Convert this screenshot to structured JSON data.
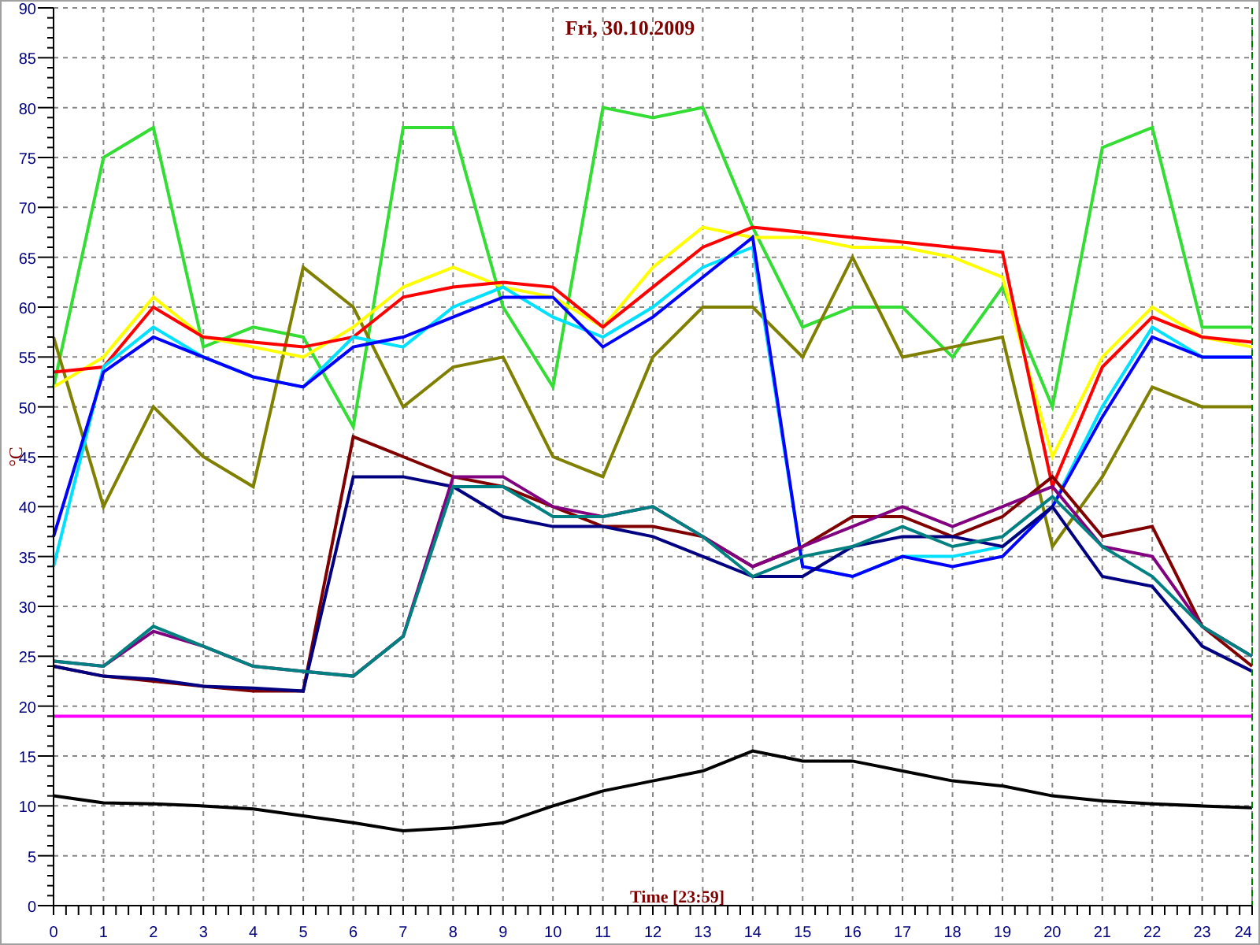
{
  "chart": {
    "chart_data": {
      "type": "line",
      "title": "Fri, 30.10.2009",
      "xlabel": "Time [23:59]",
      "ylabel": "°C",
      "x": [
        0,
        1,
        2,
        3,
        4,
        5,
        6,
        7,
        8,
        9,
        10,
        11,
        12,
        13,
        14,
        15,
        16,
        17,
        18,
        19,
        20,
        21,
        22,
        23,
        24
      ],
      "grid": true,
      "xlim": [
        0,
        24
      ],
      "ylim": [
        0,
        90
      ],
      "xticks": [
        0,
        1,
        2,
        3,
        4,
        5,
        6,
        7,
        8,
        9,
        10,
        11,
        12,
        13,
        14,
        15,
        16,
        17,
        18,
        19,
        20,
        21,
        22,
        23,
        24
      ],
      "yticks": [
        0,
        5,
        10,
        15,
        20,
        25,
        30,
        35,
        40,
        45,
        50,
        55,
        60,
        65,
        70,
        75,
        80,
        85,
        90
      ],
      "series": [
        {
          "color": "#33dd33",
          "values": [
            52,
            75,
            78,
            56,
            58,
            57,
            48,
            78,
            78,
            60,
            52,
            80,
            79,
            80,
            68,
            58,
            60,
            60,
            55,
            62,
            50,
            76,
            78,
            58,
            58
          ]
        },
        {
          "color": "#808000",
          "values": [
            57,
            40,
            50,
            45,
            42,
            64,
            60,
            50,
            54,
            55,
            45,
            43,
            55,
            60,
            60,
            55,
            65,
            55,
            56,
            57,
            36,
            43,
            52,
            50,
            50
          ]
        },
        {
          "color": "#ffff00",
          "values": [
            52,
            55,
            61,
            57,
            56,
            55,
            58,
            62,
            64,
            62,
            61,
            58,
            64,
            68,
            67,
            67,
            66,
            66,
            65,
            63,
            45,
            55,
            60,
            57,
            56
          ]
        },
        {
          "color": "#ff0000",
          "values": [
            53.5,
            54,
            60,
            57,
            56.5,
            56,
            57,
            61,
            62,
            62.5,
            62,
            58,
            62,
            66,
            68,
            67.5,
            67,
            66.5,
            66,
            65.5,
            42,
            54,
            59,
            57,
            56.5
          ]
        },
        {
          "color": "#00e0ff",
          "values": [
            34,
            54,
            58,
            55,
            53,
            52,
            57,
            56,
            60,
            62,
            59,
            57,
            60,
            64,
            66,
            34,
            33,
            35,
            35,
            36,
            40,
            50,
            58,
            55,
            55
          ]
        },
        {
          "color": "#0000ff",
          "values": [
            37,
            53.5,
            57,
            55,
            53,
            52,
            56,
            57,
            59,
            61,
            61,
            56,
            59,
            63,
            67,
            34,
            33,
            35,
            34,
            35,
            40,
            49,
            57,
            55,
            55
          ]
        },
        {
          "color": "#800000",
          "values": [
            24,
            23,
            22.5,
            22,
            21.5,
            21.5,
            47,
            45,
            43,
            42,
            40,
            38,
            38,
            37,
            34,
            36,
            39,
            39,
            37,
            39,
            43,
            37,
            38,
            28,
            24
          ]
        },
        {
          "color": "#000080",
          "values": [
            24,
            23,
            22.7,
            22,
            21.8,
            21.5,
            43,
            43,
            42,
            39,
            38,
            38,
            37,
            35,
            33,
            33,
            36,
            37,
            37,
            36,
            40,
            33,
            32,
            26,
            23.5
          ]
        },
        {
          "color": "#800080",
          "values": [
            24.5,
            24,
            27.5,
            26,
            24,
            23.5,
            23,
            27,
            43,
            43,
            40,
            39,
            40,
            37,
            34,
            36,
            38,
            40,
            38,
            40,
            42,
            36,
            35,
            28,
            25
          ]
        },
        {
          "color": "#008080",
          "values": [
            24.5,
            24,
            28,
            26,
            24,
            23.5,
            23,
            27,
            42,
            42,
            39,
            39,
            40,
            37,
            33,
            35,
            36,
            38,
            36,
            37,
            41,
            36,
            33,
            28,
            25
          ]
        },
        {
          "color": "#ff00ff",
          "values": [
            19,
            19,
            19,
            19,
            19,
            19,
            19,
            19,
            19,
            19,
            19,
            19,
            19,
            19,
            19,
            19,
            19,
            19,
            19,
            19,
            19,
            19,
            19,
            19,
            19
          ]
        },
        {
          "color": "#000000",
          "values": [
            11,
            10.3,
            10.2,
            10,
            9.7,
            9,
            8.3,
            7.5,
            7.8,
            8.3,
            10,
            11.5,
            12.5,
            13.5,
            15.5,
            14.5,
            14.5,
            13.5,
            12.5,
            12,
            11,
            10.5,
            10.2,
            10,
            9.8
          ]
        }
      ]
    }
  }
}
